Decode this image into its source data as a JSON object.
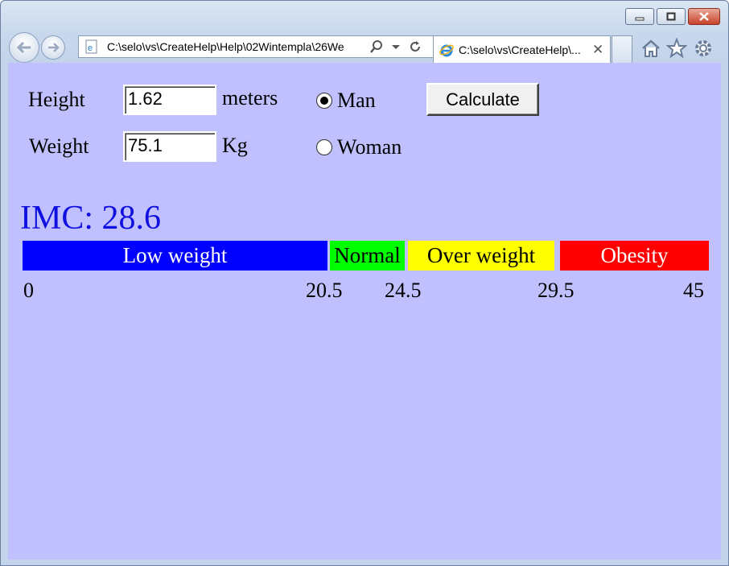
{
  "browser": {
    "address": "C:\\selo\\vs\\CreateHelp\\Help\\02Wintempla\\26We",
    "tab_title": "C:\\selo\\vs\\CreateHelp\\...",
    "tab_close": "✕"
  },
  "form": {
    "height_label": "Height",
    "height_value": "1.62",
    "height_unit": "meters",
    "weight_label": "Weight",
    "weight_value": "75.1",
    "weight_unit": "Kg",
    "gender_options": [
      "Man",
      "Woman"
    ],
    "gender_selected": "Man",
    "calculate_label": "Calculate"
  },
  "result": {
    "text": "IMC: 28.6"
  },
  "scale": {
    "segments": [
      {
        "label": "Low weight",
        "from": 0,
        "to": 20.5,
        "color": "#0000ff",
        "text_color": "#ffffff"
      },
      {
        "label": "Normal",
        "from": 20.5,
        "to": 24.5,
        "color": "#00ff00",
        "text_color": "#000000"
      },
      {
        "label": "Over weight",
        "from": 24.5,
        "to": 29.5,
        "color": "#ffff00",
        "text_color": "#000000"
      },
      {
        "label": "Obesity",
        "from": 29.5,
        "to": 45,
        "color": "#ff0000",
        "text_color": "#ffffff"
      }
    ],
    "ticks": [
      "0",
      "20.5",
      "24.5",
      "29.5",
      "45"
    ]
  },
  "colors": {
    "content_background": "#c0c0ff",
    "result_text": "#1010e0"
  }
}
